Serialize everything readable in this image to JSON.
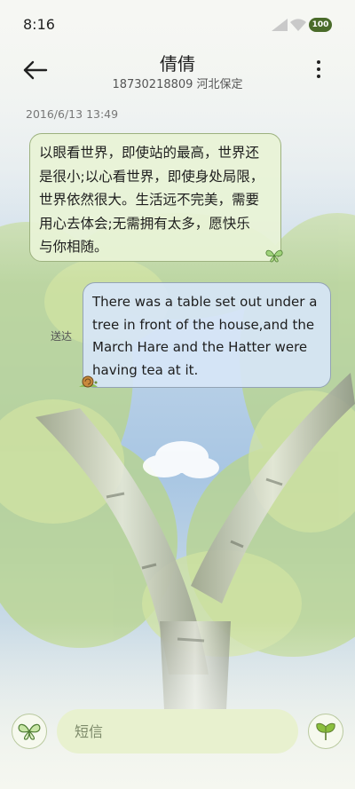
{
  "status_bar": {
    "time": "8:16",
    "battery": "100",
    "icons": [
      "signal-icon",
      "wifi-icon",
      "battery-icon"
    ]
  },
  "header": {
    "contact_name": "倩倩",
    "contact_info": "18730218809 河北保定",
    "icons": [
      "back-arrow-icon",
      "more-options-icon"
    ]
  },
  "conversation": {
    "date": "2016/6/13 13:49",
    "messages": [
      {
        "direction": "incoming",
        "text": "以眼看世界，即使站的最高，世界还\n是很小;以心看世界，即使身处局限，\n世界依然很大。生活远不完美，需要\n用心去体会;无需拥有太多，愿快乐\n与你相随。",
        "decoration": "butterfly-icon"
      },
      {
        "direction": "outgoing",
        "status": "送达",
        "text": "There was a table set out under a\ntree in front of the house,and the\nMarch Hare and the Hatter were\nhaving tea at it.",
        "decoration": "snail-icon"
      }
    ]
  },
  "composer": {
    "placeholder": "短信",
    "left_icon": "butterfly-icon",
    "send_icon": "ginkgo-leaf-icon"
  },
  "colors": {
    "incoming_bubble": "#e8f3d6",
    "outgoing_bubble": "#d6e5f6",
    "input_background": "#e8f1cf"
  }
}
